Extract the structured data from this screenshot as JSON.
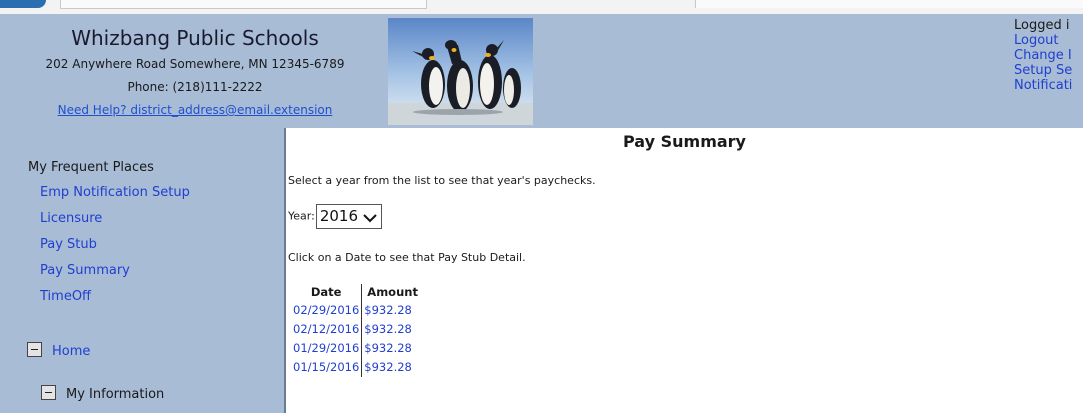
{
  "header": {
    "school_name": "Whizbang Public Schools",
    "address": "202 Anywhere Road Somewhere, MN 12345-6789",
    "phone": "Phone: (218)111-2222",
    "help_link": "Need Help? district_address@email.extension"
  },
  "account": {
    "logged_in": "Logged i",
    "logout": "Logout",
    "change": "Change I",
    "setup": "Setup Se",
    "notifications": "Notificati"
  },
  "sidebar": {
    "frequent_title": "My Frequent Places",
    "items": [
      "Emp Notification Setup",
      "Licensure",
      "Pay Stub",
      "Pay Summary",
      "TimeOff"
    ],
    "tree": {
      "home": "Home",
      "my_information": "My Information"
    }
  },
  "main": {
    "title": "Pay Summary",
    "hint_year": "Select a year from the list to see that year's paychecks.",
    "year_label": "Year:",
    "year_value": "2016",
    "hint_date": "Click on a Date to see that Pay Stub Detail.",
    "table": {
      "headers": [
        "Date",
        "Amount"
      ],
      "rows": [
        [
          "02/29/2016",
          "$932.28"
        ],
        [
          "02/12/2016",
          "$932.28"
        ],
        [
          "01/29/2016",
          "$932.28"
        ],
        [
          "01/15/2016",
          "$932.28"
        ]
      ]
    }
  },
  "icons": {
    "header_image": "penguins-image",
    "collapse": "minus-box-icon",
    "dropdown": "chevron-down-icon"
  },
  "colors": {
    "header_bg": "#a8bcd6",
    "link": "#1f3fcf"
  }
}
